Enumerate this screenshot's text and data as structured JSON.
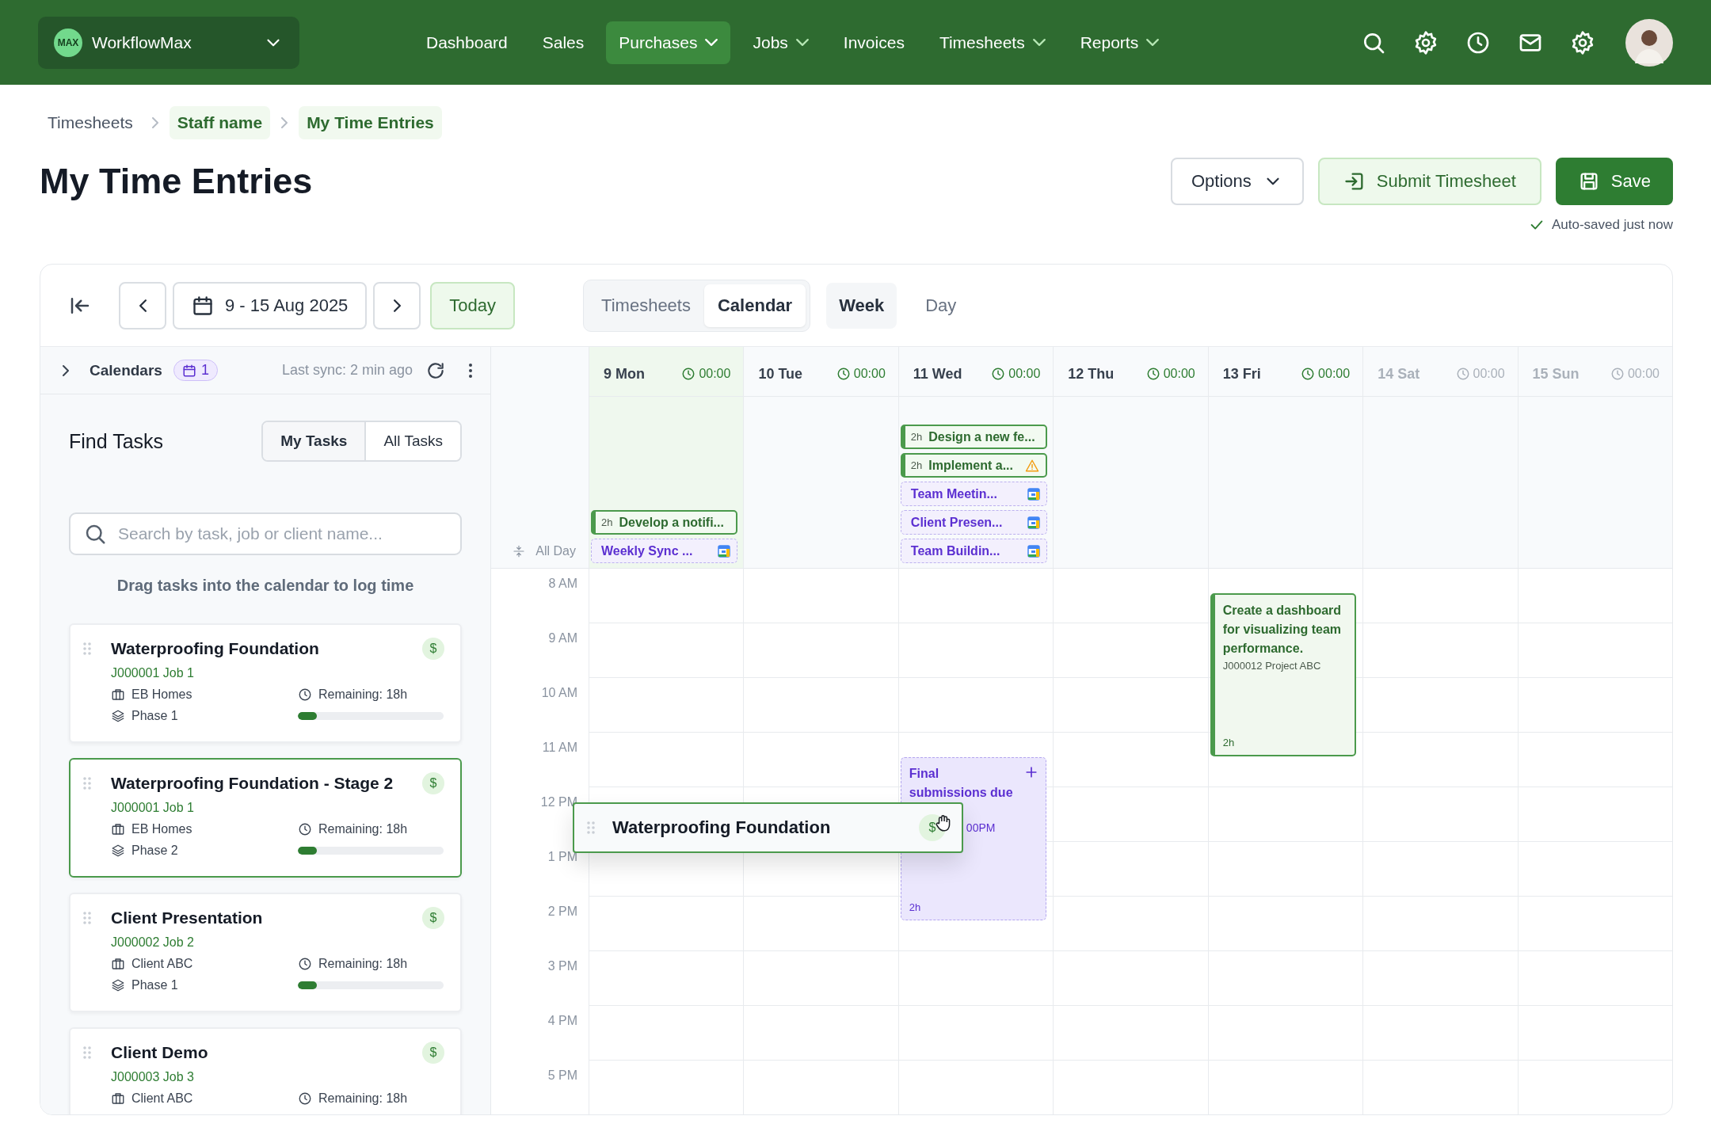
{
  "nav": {
    "logo": "MAX",
    "brand": "WorkflowMax",
    "items": [
      {
        "label": "Dashboard",
        "dropdown": false,
        "selected": false
      },
      {
        "label": "Sales",
        "dropdown": false,
        "selected": false
      },
      {
        "label": "Purchases",
        "dropdown": true,
        "selected": true
      },
      {
        "label": "Jobs",
        "dropdown": true,
        "selected": false
      },
      {
        "label": "Invoices",
        "dropdown": false,
        "selected": false
      },
      {
        "label": "Timesheets",
        "dropdown": true,
        "selected": false
      },
      {
        "label": "Reports",
        "dropdown": true,
        "selected": false
      }
    ]
  },
  "breadcrumb": [
    {
      "label": "Timesheets",
      "highlighted": false
    },
    {
      "label": "Staff name",
      "highlighted": true
    },
    {
      "label": "My Time Entries",
      "highlighted": true
    }
  ],
  "title": "My Time Entries",
  "actions": {
    "options": "Options",
    "submit": "Submit Timesheet",
    "save": "Save",
    "autosave": "Auto-saved just now"
  },
  "toolbar": {
    "date_range": "9 - 15 Aug 2025",
    "today": "Today",
    "modes": [
      {
        "label": "Timesheets",
        "selected": false
      },
      {
        "label": "Calendar",
        "selected": true
      }
    ],
    "views": [
      {
        "label": "Week",
        "selected": true
      },
      {
        "label": "Day",
        "selected": false
      }
    ]
  },
  "sidebar": {
    "calendars": {
      "label": "Calendars",
      "count": "1",
      "sync": "Last sync: 2 min ago"
    },
    "heading": "Find Tasks",
    "filters": [
      {
        "label": "My Tasks",
        "selected": true
      },
      {
        "label": "All Tasks",
        "selected": false
      }
    ],
    "search": {
      "placeholder": "Search by task, job or client name..."
    },
    "hint": "Drag tasks into the calendar to log time",
    "tasks": [
      {
        "title": "Waterproofing Foundation",
        "badge": "$",
        "job": "J000001 Job 1",
        "client": "EB Homes",
        "phase": "Phase 1",
        "remaining": "Remaining: 18h",
        "level": 0.13,
        "selected": false
      },
      {
        "title": "Waterproofing Foundation - Stage 2",
        "badge": "$",
        "job": "J000001 Job 1",
        "client": "EB Homes",
        "phase": "Phase 2",
        "remaining": "Remaining: 18h",
        "level": 0.13,
        "selected": true
      },
      {
        "title": "Client Presentation",
        "badge": "$",
        "job": "J000002 Job 2",
        "client": "Client ABC",
        "phase": "Phase 1",
        "remaining": "Remaining: 18h",
        "level": 0.13,
        "selected": false
      },
      {
        "title": "Client Demo",
        "badge": "$",
        "job": "J000003 Job 3",
        "client": "Client ABC",
        "remaining": "Remaining: 18h",
        "selected": false
      }
    ]
  },
  "calendar": {
    "all_day_label": "All Day",
    "hours": [
      "8 AM",
      "9 AM",
      "10 AM",
      "11 AM",
      "12 PM",
      "1 PM",
      "2 PM",
      "3 PM",
      "4 PM",
      "5 PM"
    ],
    "days": [
      {
        "label": "9 Mon",
        "total": "00:00",
        "today": true,
        "weekend": false,
        "all_day": [
          {
            "kind": "task",
            "duration": "2h",
            "title": "Develop a notifi...",
            "warning": false
          },
          {
            "kind": "meeting",
            "title": "Weekly Sync ..."
          }
        ]
      },
      {
        "label": "10 Tue",
        "total": "00:00",
        "today": false,
        "weekend": false
      },
      {
        "label": "11 Wed",
        "total": "00:00",
        "today": false,
        "weekend": false,
        "all_day": [
          {
            "kind": "task",
            "duration": "2h",
            "title": "Design a new fe...",
            "warning": false
          },
          {
            "kind": "task",
            "duration": "2h",
            "title": "Implement a...",
            "warning": true
          },
          {
            "kind": "meeting",
            "title": "Team Meetin..."
          },
          {
            "kind": "meeting",
            "title": "Client Presen..."
          },
          {
            "kind": "meeting",
            "title": "Team Buildin..."
          }
        ],
        "events": [
          {
            "kind": "meeting",
            "title": "Final submissions due",
            "time": "00PM",
            "duration": "2h"
          }
        ]
      },
      {
        "label": "12 Thu",
        "total": "00:00",
        "today": false,
        "weekend": false
      },
      {
        "label": "13 Fri",
        "total": "00:00",
        "today": false,
        "weekend": false,
        "events": [
          {
            "kind": "task",
            "title": "Create a dashboard for visualizing team performance.",
            "job": "J000012 Project ABC",
            "duration": "2h"
          }
        ]
      },
      {
        "label": "14 Sat",
        "total": "00:00",
        "today": false,
        "weekend": true
      },
      {
        "label": "15 Sun",
        "total": "00:00",
        "today": false,
        "weekend": true
      }
    ],
    "dragging": {
      "title": "Waterproofing Foundation",
      "badge": "$"
    }
  }
}
